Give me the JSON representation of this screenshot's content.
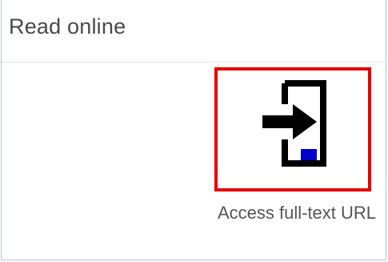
{
  "panel": {
    "title": "Read online"
  },
  "fulltext_link": {
    "icon": "enter-door-icon",
    "label": "Access full-text URL",
    "highlight_color": "#e60000",
    "accent_color": "#0000cc"
  }
}
